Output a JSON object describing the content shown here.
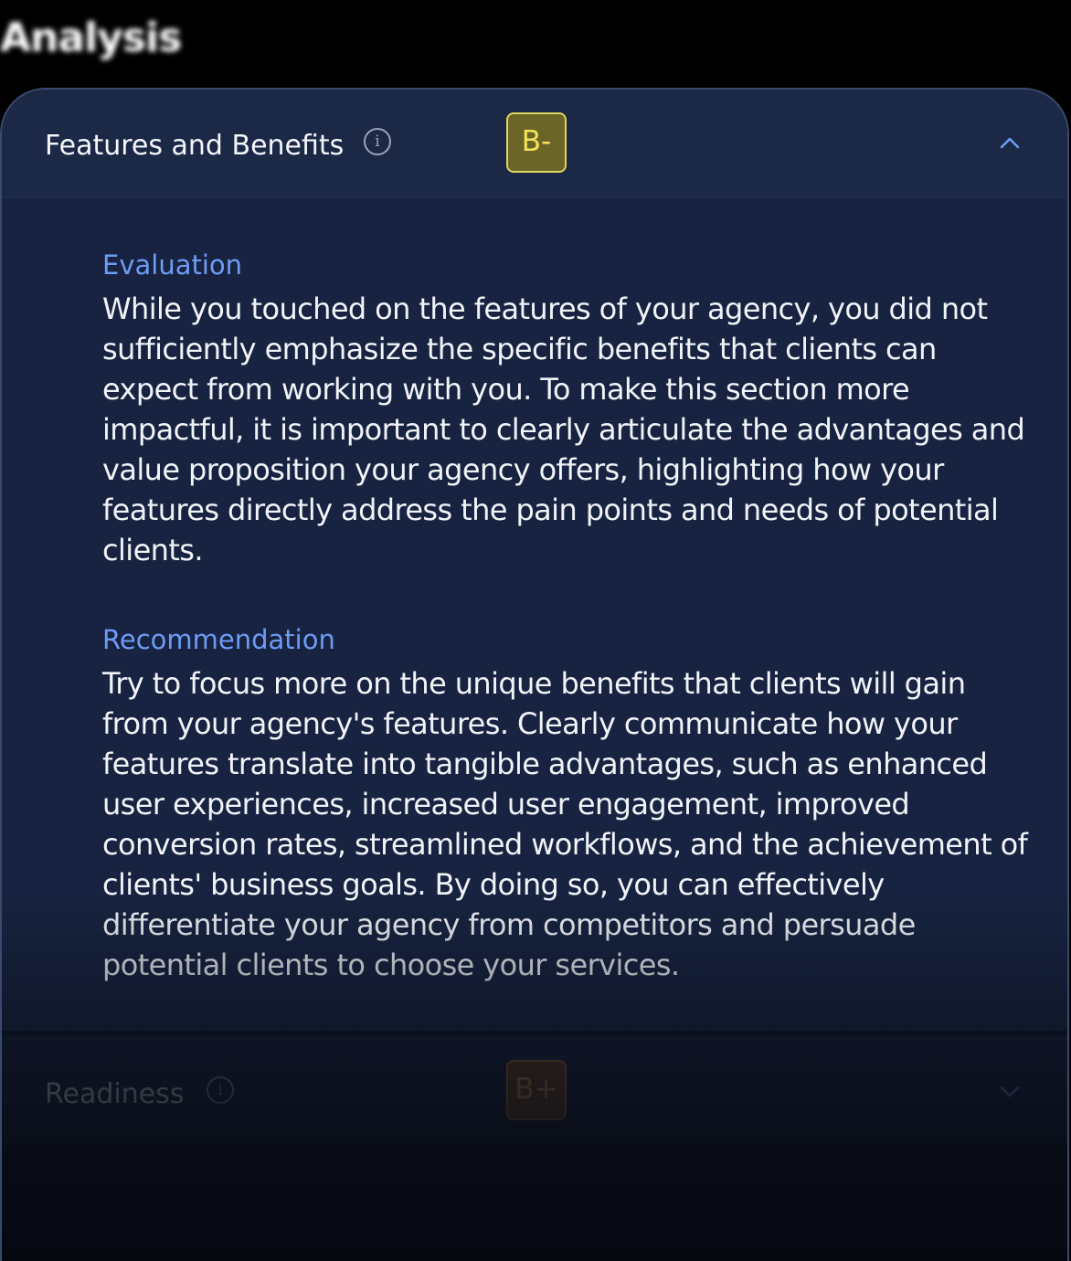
{
  "page": {
    "heading": "Analysis"
  },
  "sections": [
    {
      "title": "Features and Benefits",
      "info_icon": "info-icon",
      "grade": "B-",
      "grade_color": "#f2e35a",
      "expanded": true,
      "toggle_icon": "chevron-up-icon",
      "evaluation_label": "Evaluation",
      "evaluation_text": "While you touched on the features of your agency, you did not sufficiently emphasize the specific benefits that clients can expect from working with you. To make this section more impactful, it is important to clearly articulate the advantages and value proposition your agency offers, highlighting how your features directly address the pain points and needs of potential clients.",
      "recommendation_label": "Recommendation",
      "recommendation_text": "Try to focus more on the unique benefits that clients will gain from your agency's features. Clearly communicate how your features translate into tangible advantages, such as enhanced user experiences, increased user engagement, improved conversion rates, streamlined workflows, and the achievement of clients' business goals. By doing so, you can effectively differentiate your agency from competitors and persuade potential clients to choose your services."
    },
    {
      "title": "Readiness",
      "info_icon": "info-icon",
      "grade": "B+",
      "grade_color": "#f0a55a",
      "expanded": false,
      "toggle_icon": "chevron-down-icon"
    }
  ],
  "colors": {
    "background": "#000000",
    "panel": "#172340",
    "header": "#1b2846",
    "accent_label": "#6f9bf5",
    "chevron": "#6f9bf5"
  }
}
